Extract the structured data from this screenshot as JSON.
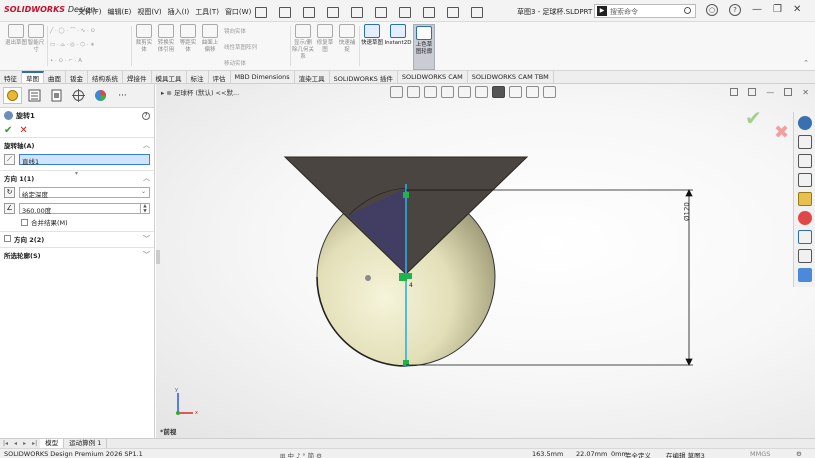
{
  "app": {
    "logo": "SOLIDWORKS",
    "logo_sub": "Design",
    "document_title": "草图3 - 足球杯.SLDPRT"
  },
  "menu": [
    "文件(F)",
    "编辑(E)",
    "视图(V)",
    "插入(I)",
    "工具(T)",
    "窗口(W)"
  ],
  "search": {
    "placeholder": "搜索命令"
  },
  "ribbon": {
    "buttons": [
      {
        "label": "退出草图"
      },
      {
        "label": "智能尺寸"
      },
      {
        "label": "裁剪实体"
      },
      {
        "label": "转换实体引用"
      },
      {
        "label": "等距实体"
      },
      {
        "label": "曲面上偏移"
      },
      {
        "label": "显示/删除几何关系"
      },
      {
        "label": "修复草图"
      },
      {
        "label": "快速捕捉"
      },
      {
        "label": "快速草图"
      },
      {
        "label": "Instant2D"
      },
      {
        "label": "上色草图轮廓"
      }
    ],
    "small": [
      "镜向实体",
      "线性草图阵列",
      "移动实体"
    ]
  },
  "command_tabs": [
    "特征",
    "草图",
    "曲面",
    "钣金",
    "结构系统",
    "焊接件",
    "模具工具",
    "标注",
    "评估",
    "MBD Dimensions",
    "渲染工具",
    "SOLIDWORKS 插件",
    "SOLIDWORKS CAM",
    "SOLIDWORKS CAM TBM"
  ],
  "active_command_tab": "草图",
  "property_manager": {
    "title": "旋转1",
    "axis_section": {
      "title": "旋转轴(A)",
      "value": "直线1"
    },
    "direction1_section": {
      "title": "方向 1(1)",
      "end_condition": "给定深度",
      "angle": "360.00度",
      "merge_label": "合并结果(M)"
    },
    "direction2_section": {
      "title": "方向 2(2)"
    },
    "contours_section": {
      "title": "所选轮廓(S)"
    }
  },
  "viewport": {
    "breadcrumb": "足球杯 (默认) <<默...",
    "view_label": "*前视",
    "dimension_text": "Ø120",
    "point_label": "4"
  },
  "bottom_tabs": [
    "模型",
    "运动算例 1"
  ],
  "status": {
    "product": "SOLIDWORKS Design Premium 2026 SP1.1",
    "x": "163.5mm",
    "y": "22.07mm",
    "z": "0mm",
    "defined": "完全定义",
    "editing": "在编辑 草图3",
    "units": "MMGS"
  },
  "colors": {
    "accent": "#2a6fb0",
    "cone": "#4a4540",
    "sphere": "#e2dfb8",
    "axis": "#2ab0e0",
    "point": "#22b14c"
  }
}
